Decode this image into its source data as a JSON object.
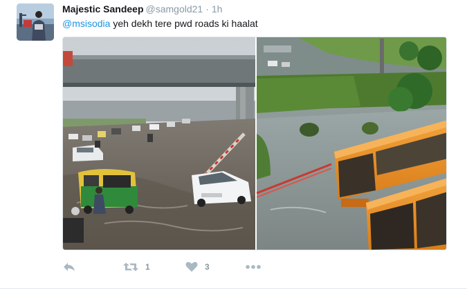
{
  "tweet": {
    "author": {
      "name": "Majestic Sandeep",
      "handle": "@samgold21"
    },
    "separator": "·",
    "timestamp": "1h",
    "mention": "@msisodia",
    "text": " yeh dekh tere pwd roads ki haalat",
    "media": {
      "left_scene": "flooded-underpass-traffic",
      "right_scene": "flooded-road-orange-buses"
    },
    "actions": {
      "reply_icon": "reply-arrow-icon",
      "retweet_icon": "retweet-icon",
      "retweet_count": "1",
      "like_icon": "heart-icon",
      "like_count": "3",
      "more_icon": "more-dots-icon"
    },
    "colors": {
      "mention": "#1b95e0",
      "muted": "#8899a6",
      "action_icon": "#aab8c2"
    }
  }
}
